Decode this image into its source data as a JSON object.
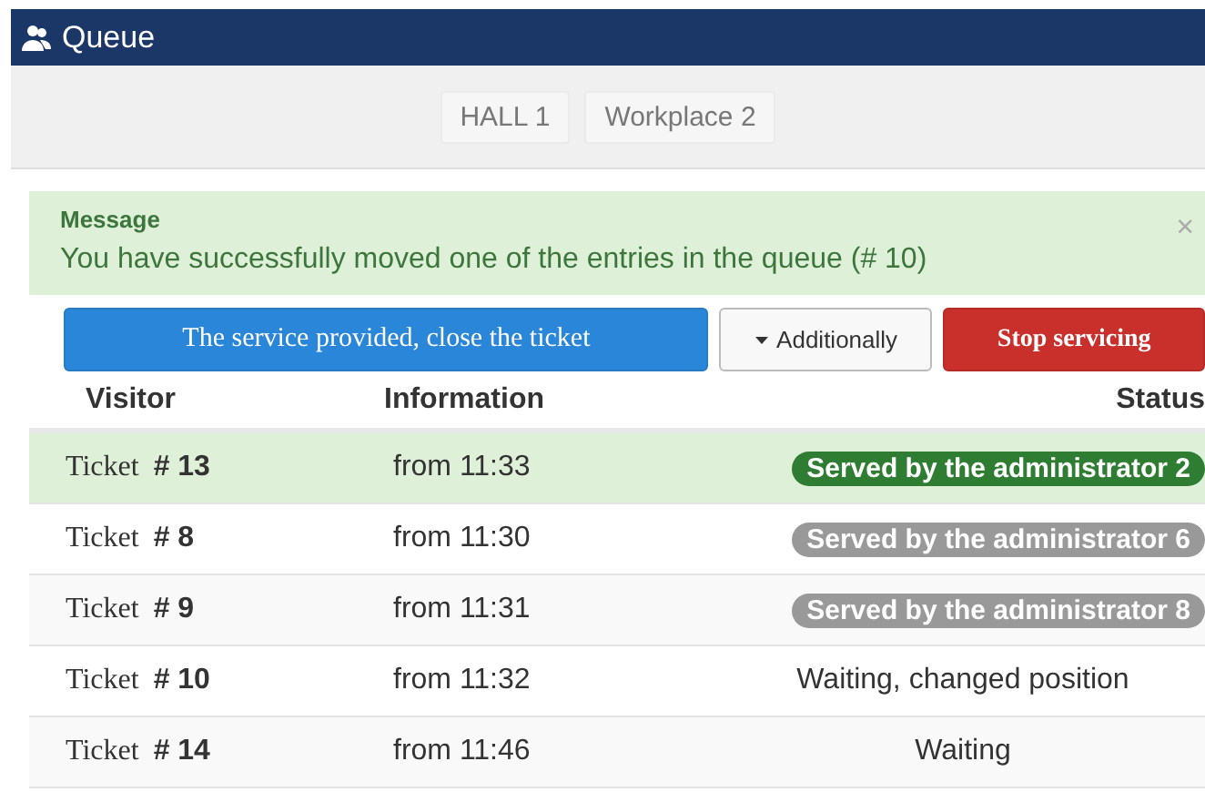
{
  "window": {
    "title": "Queue"
  },
  "tabs": [
    {
      "label": "HALL 1",
      "selected": false
    },
    {
      "label": "Workplace 2",
      "selected": false
    }
  ],
  "message": {
    "title": "Message",
    "text": "You have successfully moved one of the entries in the queue (# 10)",
    "close": "×"
  },
  "actions": [
    {
      "kind": "primary",
      "label": "The service provided, close the ticket"
    },
    {
      "kind": "dropdown",
      "label": "Additionally"
    },
    {
      "kind": "danger",
      "label": "Stop servicing"
    }
  ],
  "table": {
    "columns": [
      "Visitor",
      "Information",
      "Status"
    ],
    "rows": [
      {
        "selected": true,
        "ticket": "Ticket",
        "number": "# 13",
        "info": "from 11:33",
        "status": {
          "kind": "badge",
          "color": "#2e7d32",
          "text": "Served by the administrator 2"
        }
      },
      {
        "selected": false,
        "ticket": "Ticket",
        "number": "# 8",
        "info": "from 11:30",
        "status": {
          "kind": "badge",
          "color": "#999999",
          "text": "Served by the administrator 6"
        }
      },
      {
        "selected": false,
        "ticket": "Ticket",
        "number": "# 9",
        "info": "from 11:31",
        "status": {
          "kind": "badge",
          "color": "#999999",
          "text": "Served by the administrator 8"
        }
      },
      {
        "selected": false,
        "ticket": "Ticket",
        "number": "# 10",
        "info": "from 11:32",
        "status": {
          "kind": "text",
          "text": "Waiting, changed position"
        }
      },
      {
        "selected": false,
        "ticket": "Ticket",
        "number": "# 14",
        "info": "from 11:46",
        "status": {
          "kind": "text",
          "text": "Waiting"
        }
      }
    ]
  }
}
